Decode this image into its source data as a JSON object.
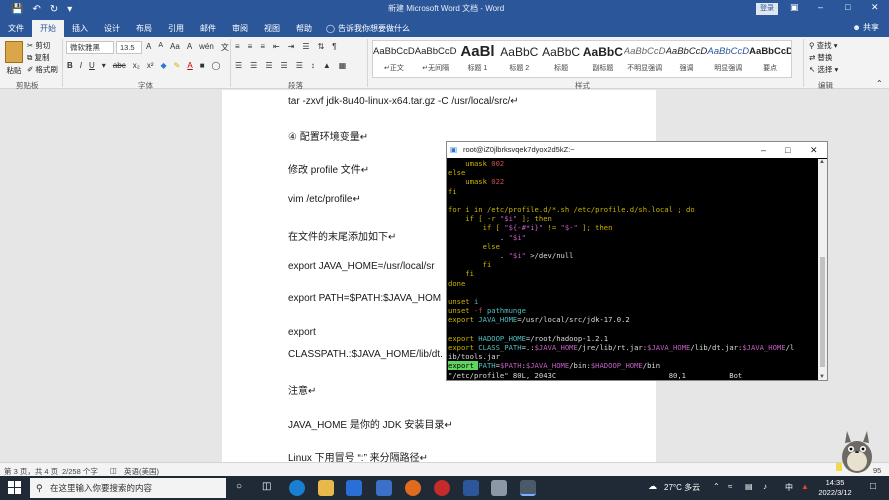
{
  "window": {
    "title": "新建 Microsoft Word 文档 - Word",
    "login_label": "登录",
    "share_label": "共享"
  },
  "ribbon_tabs": [
    "文件",
    "开始",
    "插入",
    "设计",
    "布局",
    "引用",
    "邮件",
    "审阅",
    "视图",
    "帮助"
  ],
  "tell_me": "告诉我你想要做什么",
  "clipboard": {
    "paste_label": "粘贴",
    "cut_label": "剪切",
    "copy_label": "复制",
    "format_painter_label": "格式刷",
    "group_label": "剪贴板"
  },
  "font": {
    "font_name": "微软雅黑",
    "font_size": "13.5",
    "group_label": "字体",
    "bold": "B",
    "italic": "I",
    "underline": "U",
    "strike": "abc",
    "subscript": "x₂",
    "superscript": "x²",
    "font_color": "A",
    "wen": "wén",
    "size_up": "A",
    "size_down": "A",
    "aa": "Aa",
    "clear": "A",
    "wen2": "文"
  },
  "paragraph": {
    "group_label": "段落"
  },
  "styles": {
    "group_label": "样式",
    "items": [
      {
        "preview": "AaBbCcDc",
        "name": "↵正文"
      },
      {
        "preview": "AaBbCcDc",
        "name": "↵无间隔"
      },
      {
        "preview": "AaBl",
        "name": "标题 1"
      },
      {
        "preview": "AaBbC",
        "name": "标题 2"
      },
      {
        "preview": "AaBbC",
        "name": "标题"
      },
      {
        "preview": "AaBbC",
        "name": "副标题"
      },
      {
        "preview": "AaBbCcDc",
        "name": "不明显强调"
      },
      {
        "preview": "AaBbCcDc",
        "name": "强调"
      },
      {
        "preview": "AaBbCcDc",
        "name": "明显强调"
      },
      {
        "preview": "AaBbCcD",
        "name": "要点"
      }
    ]
  },
  "editing": {
    "group_label": "编辑",
    "find_label": "查找",
    "replace_label": "替换",
    "select_label": "选择"
  },
  "document": {
    "lines": [
      "tar -zxvf jdk-8u40-linux-x64.tar.gz -C /usr/local/src/↵",
      "④ 配置环境变量↵",
      "修改 profile 文件↵",
      "vim /etc/profile↵",
      "在文件的末尾添加如下↵",
      "export JAVA_HOME=/usr/local/sr",
      "export PATH=$PATH:$JAVA_HOM",
      "export",
      "CLASSPATH.:$JAVA_HOME/lib/dt.",
      "注意↵",
      "JAVA_HOME 是你的 JDK 安装目录↵",
      "Linux 下用冒号 “:” 来分隔路径↵"
    ]
  },
  "terminal": {
    "title": "root@iZ0jlbrksvqek7dyox2d5kZ:~",
    "lines": [
      [
        {
          "t": "    umask ",
          "c": "c-yel"
        },
        {
          "t": "002",
          "c": "c-red"
        }
      ],
      [
        {
          "t": "else",
          "c": "c-yel"
        }
      ],
      [
        {
          "t": "    umask ",
          "c": "c-yel"
        },
        {
          "t": "022",
          "c": "c-red"
        }
      ],
      [
        {
          "t": "fi",
          "c": "c-yel"
        }
      ],
      [
        {
          "t": "",
          "c": "c-wht"
        }
      ],
      [
        {
          "t": "for i in /etc/profile.d/*.sh /etc/profile.d/sh.local ; do",
          "c": "c-yel"
        }
      ],
      [
        {
          "t": "    if [ -r ",
          "c": "c-yel"
        },
        {
          "t": "\"$i\"",
          "c": "c-mag"
        },
        {
          "t": " ]; then",
          "c": "c-yel"
        }
      ],
      [
        {
          "t": "        if [ ",
          "c": "c-yel"
        },
        {
          "t": "\"${-#*i}\"",
          "c": "c-mag"
        },
        {
          "t": " != ",
          "c": "c-yel"
        },
        {
          "t": "\"$-\"",
          "c": "c-mag"
        },
        {
          "t": " ]; then",
          "c": "c-yel"
        }
      ],
      [
        {
          "t": "            . ",
          "c": "c-wht"
        },
        {
          "t": "\"$i\"",
          "c": "c-mag"
        }
      ],
      [
        {
          "t": "        else",
          "c": "c-yel"
        }
      ],
      [
        {
          "t": "            . ",
          "c": "c-wht"
        },
        {
          "t": "\"$i\"",
          "c": "c-mag"
        },
        {
          "t": " >/dev/null",
          "c": "c-wht"
        }
      ],
      [
        {
          "t": "        fi",
          "c": "c-yel"
        }
      ],
      [
        {
          "t": "    fi",
          "c": "c-yel"
        }
      ],
      [
        {
          "t": "done",
          "c": "c-yel"
        }
      ],
      [
        {
          "t": "",
          "c": "c-wht"
        }
      ],
      [
        {
          "t": "unset ",
          "c": "c-yel"
        },
        {
          "t": "i",
          "c": "c-cyn"
        }
      ],
      [
        {
          "t": "unset ",
          "c": "c-yel"
        },
        {
          "t": "-f",
          "c": "c-red"
        },
        {
          "t": " pathmunge",
          "c": "c-cyn"
        }
      ],
      [
        {
          "t": "export ",
          "c": "c-yel"
        },
        {
          "t": "JAVA_HOME",
          "c": "c-cyn"
        },
        {
          "t": "=/usr/local/src/jdk-17.0.2",
          "c": "c-wht"
        }
      ],
      [
        {
          "t": "",
          "c": "c-wht"
        }
      ],
      [
        {
          "t": "export ",
          "c": "c-yel"
        },
        {
          "t": "HADOOP_HOME",
          "c": "c-cyn"
        },
        {
          "t": "=/root/hadoop-1.2.1",
          "c": "c-wht"
        }
      ],
      [
        {
          "t": "export ",
          "c": "c-yel"
        },
        {
          "t": "CLASS_PATH",
          "c": "c-cyn"
        },
        {
          "t": "=.:",
          "c": "c-wht"
        },
        {
          "t": "$JAVA_HOME",
          "c": "c-mag"
        },
        {
          "t": "/jre/lib/rt.jar:",
          "c": "c-wht"
        },
        {
          "t": "$JAVA_HOME",
          "c": "c-mag"
        },
        {
          "t": "/lib/dt.jar:",
          "c": "c-wht"
        },
        {
          "t": "$JAVA_HOME",
          "c": "c-mag"
        },
        {
          "t": "/l",
          "c": "c-wht"
        }
      ],
      [
        {
          "t": "ib/tools.jar",
          "c": "c-wht"
        }
      ],
      [
        {
          "t": "export ",
          "c": "c-yel"
        },
        {
          "t": "PATH",
          "c": "c-cyn"
        },
        {
          "t": "=",
          "c": "c-wht"
        },
        {
          "t": "$PATH",
          "c": "c-mag"
        },
        {
          "t": ":",
          "c": "c-wht"
        },
        {
          "t": "$JAVA_HOME",
          "c": "c-mag"
        },
        {
          "t": "/bin:",
          "c": "c-wht"
        },
        {
          "t": "$HADOOP_HOME",
          "c": "c-mag"
        },
        {
          "t": "/bin",
          "c": "c-wht"
        }
      ],
      [
        {
          "t": "\"/etc/profile\" 80L, 2043C",
          "c": "c-wht"
        },
        {
          "t": "                          80,1          Bot",
          "c": "c-wht"
        }
      ]
    ]
  },
  "statusbar": {
    "page": "第 3 页，共 4 页",
    "words": "2/258 个字",
    "lang": "英语(美国)",
    "zoom": "95"
  },
  "taskbar": {
    "search_placeholder": "在这里输入你要搜索的内容",
    "weather": "27°C 多云",
    "ime": "中",
    "time": "14:35",
    "date": "2022/3/12"
  }
}
